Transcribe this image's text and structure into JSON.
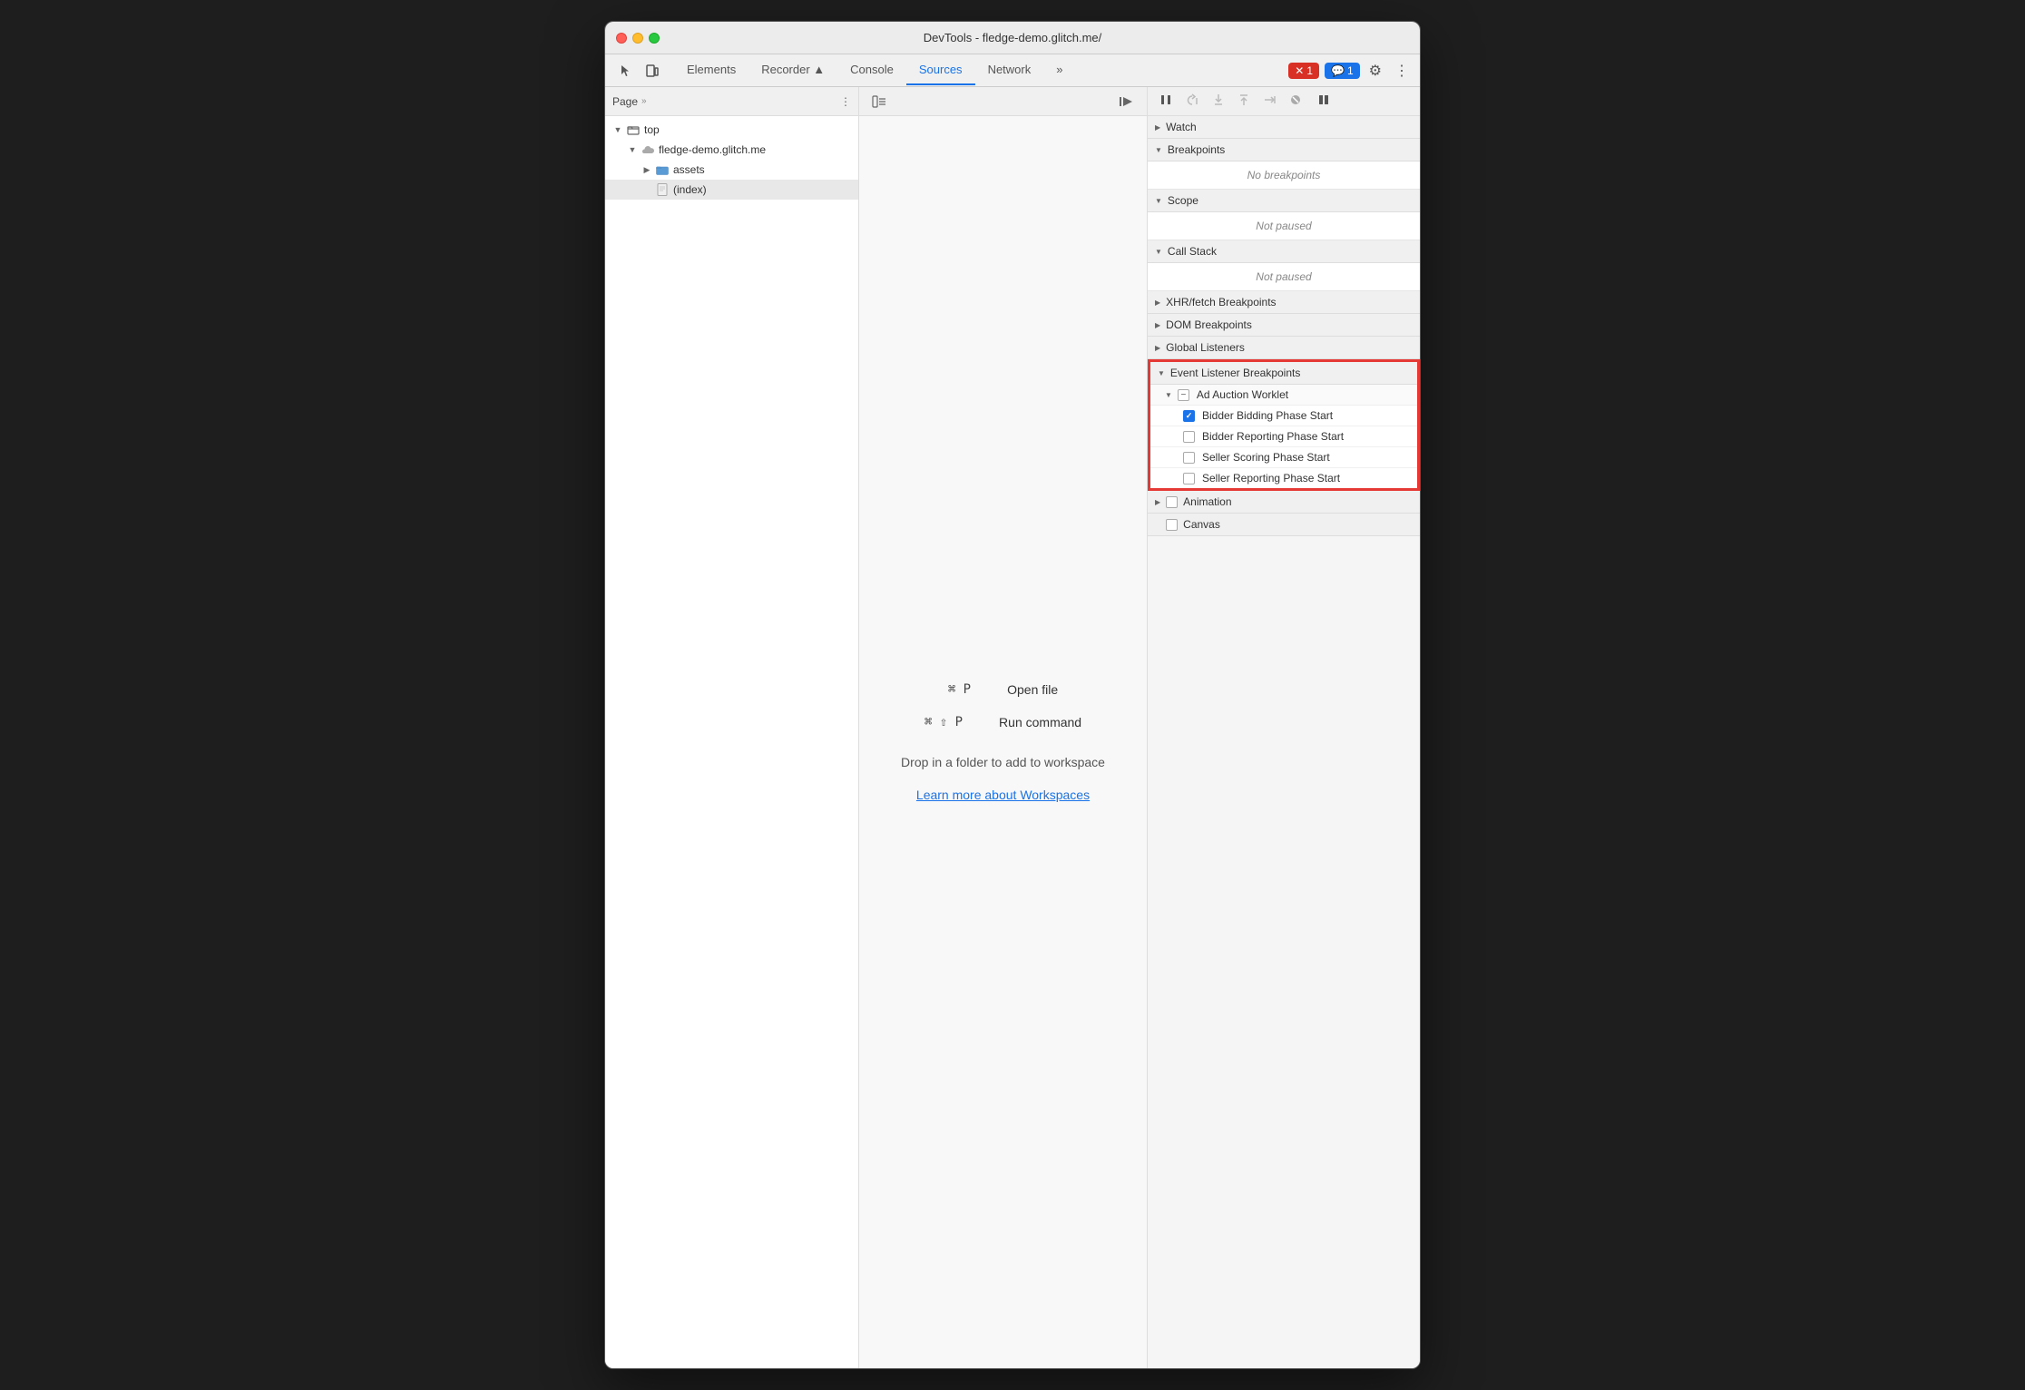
{
  "window": {
    "title": "DevTools - fledge-demo.glitch.me/"
  },
  "toolbar": {
    "tabs": [
      {
        "label": "Elements",
        "active": false
      },
      {
        "label": "Recorder ▲",
        "active": false
      },
      {
        "label": "Console",
        "active": false
      },
      {
        "label": "Sources",
        "active": true
      },
      {
        "label": "Network",
        "active": false
      }
    ],
    "more_tabs": "»",
    "error_badge": "1",
    "info_badge": "1"
  },
  "left_panel": {
    "header_title": "Page",
    "header_more": "»",
    "tree": [
      {
        "label": "top",
        "type": "folder",
        "depth": 1,
        "expanded": true,
        "arrow": "▼"
      },
      {
        "label": "fledge-demo.glitch.me",
        "type": "cloud",
        "depth": 2,
        "expanded": true,
        "arrow": "▼"
      },
      {
        "label": "assets",
        "type": "folder",
        "depth": 3,
        "expanded": false,
        "arrow": "▶"
      },
      {
        "label": "(index)",
        "type": "file",
        "depth": 3,
        "selected": true
      }
    ]
  },
  "middle_panel": {
    "shortcut1": {
      "key": "⌘ P",
      "label": "Open file"
    },
    "shortcut2": {
      "key": "⌘ ⇧ P",
      "label": "Run command"
    },
    "workspace_text": "Drop in a folder to add to workspace",
    "workspace_link": "Learn more about Workspaces"
  },
  "right_panel": {
    "sections": [
      {
        "id": "watch",
        "label": "Watch",
        "arrow": "▶",
        "collapsed": true
      },
      {
        "id": "breakpoints",
        "label": "Breakpoints",
        "arrow": "▼",
        "empty_text": "No breakpoints"
      },
      {
        "id": "scope",
        "label": "Scope",
        "arrow": "▼",
        "empty_text": "Not paused"
      },
      {
        "id": "call_stack",
        "label": "Call Stack",
        "arrow": "▼",
        "empty_text": "Not paused"
      },
      {
        "id": "xhr_breakpoints",
        "label": "XHR/fetch Breakpoints",
        "arrow": "▶",
        "collapsed": true
      },
      {
        "id": "dom_breakpoints",
        "label": "DOM Breakpoints",
        "arrow": "▶",
        "collapsed": true
      },
      {
        "id": "global_listeners",
        "label": "Global Listeners",
        "arrow": "▶",
        "collapsed": true
      }
    ],
    "event_listener_breakpoints": {
      "label": "Event Listener Breakpoints",
      "arrow": "▼",
      "sub_sections": [
        {
          "label": "Ad Auction Worklet",
          "arrow": "▼",
          "minus_box": true,
          "items": [
            {
              "label": "Bidder Bidding Phase Start",
              "checked": true
            },
            {
              "label": "Bidder Reporting Phase Start",
              "checked": false
            },
            {
              "label": "Seller Scoring Phase Start",
              "checked": false
            },
            {
              "label": "Seller Reporting Phase Start",
              "checked": false
            }
          ]
        }
      ]
    },
    "animation_section": {
      "label": "Animation",
      "arrow": "▶",
      "checkbox": false
    },
    "canvas_section": {
      "label": "Canvas",
      "checkbox": false
    }
  }
}
